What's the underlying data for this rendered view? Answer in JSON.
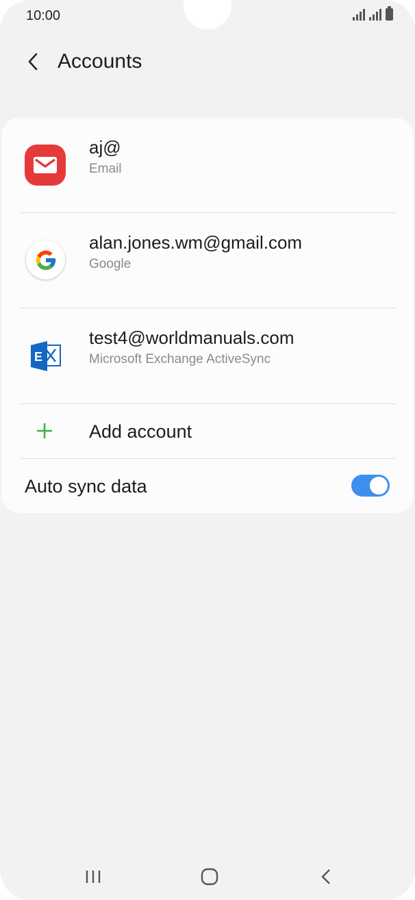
{
  "status_bar": {
    "time": "10:00",
    "signal_icon": "signal-icon",
    "battery_icon": "battery-icon"
  },
  "header": {
    "title": "Accounts",
    "back_icon": "chevron-left-icon"
  },
  "accounts": [
    {
      "name": "aj@",
      "type": "Email",
      "icon": "email-icon"
    },
    {
      "name": "alan.jones.wm@gmail.com",
      "type": "Google",
      "icon": "google-icon"
    },
    {
      "name": "test4@worldmanuals.com",
      "type": "Microsoft Exchange ActiveSync",
      "icon": "exchange-icon"
    }
  ],
  "add_account": {
    "label": "Add account",
    "icon": "plus-icon"
  },
  "auto_sync": {
    "label": "Auto sync data",
    "enabled": true
  },
  "colors": {
    "accent": "#3e8ef0",
    "email_red": "#e6393a",
    "plus_green": "#3cb043",
    "background": "#f2f2f2"
  },
  "nav_bar": {
    "recents_icon": "recents-icon",
    "home_icon": "home-icon",
    "back_icon": "back-icon"
  }
}
